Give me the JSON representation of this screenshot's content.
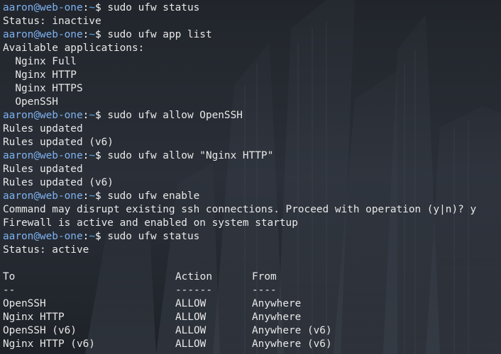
{
  "prompt": {
    "user_host": "aaron@web-one",
    "separator": ":",
    "path": "~",
    "symbol": "$"
  },
  "lines": [
    {
      "type": "prompt",
      "command": " sudo ufw status"
    },
    {
      "type": "output",
      "text": "Status: inactive"
    },
    {
      "type": "prompt",
      "command": " sudo ufw app list"
    },
    {
      "type": "output",
      "text": "Available applications:"
    },
    {
      "type": "output",
      "text": "  Nginx Full"
    },
    {
      "type": "output",
      "text": "  Nginx HTTP"
    },
    {
      "type": "output",
      "text": "  Nginx HTTPS"
    },
    {
      "type": "output",
      "text": "  OpenSSH"
    },
    {
      "type": "prompt",
      "command": " sudo ufw allow OpenSSH"
    },
    {
      "type": "output",
      "text": "Rules updated"
    },
    {
      "type": "output",
      "text": "Rules updated (v6)"
    },
    {
      "type": "prompt",
      "command": " sudo ufw allow \"Nginx HTTP\""
    },
    {
      "type": "output",
      "text": "Rules updated"
    },
    {
      "type": "output",
      "text": "Rules updated (v6)"
    },
    {
      "type": "prompt",
      "command": " sudo ufw enable"
    },
    {
      "type": "output",
      "text": "Command may disrupt existing ssh connections. Proceed with operation (y|n)? y"
    },
    {
      "type": "output",
      "text": "Firewall is active and enabled on system startup"
    },
    {
      "type": "prompt",
      "command": " sudo ufw status"
    },
    {
      "type": "output",
      "text": "Status: active"
    },
    {
      "type": "output",
      "text": ""
    }
  ],
  "table": {
    "headers": [
      "To",
      "Action",
      "From"
    ],
    "dividers": [
      "--",
      "------",
      "----"
    ],
    "rows": [
      [
        "OpenSSH",
        "ALLOW",
        "Anywhere"
      ],
      [
        "Nginx HTTP",
        "ALLOW",
        "Anywhere"
      ],
      [
        "OpenSSH (v6)",
        "ALLOW",
        "Anywhere (v6)"
      ],
      [
        "Nginx HTTP (v6)",
        "ALLOW",
        "Anywhere (v6)"
      ]
    ]
  },
  "colors": {
    "background": "#1f2329",
    "user_host": "#7fb2f0",
    "path": "#55a6e8",
    "text": "#e8e8e8"
  }
}
